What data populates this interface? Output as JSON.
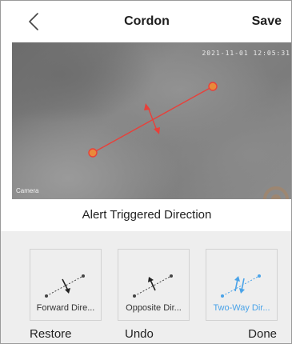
{
  "header": {
    "title": "Cordon",
    "save_label": "Save",
    "back_icon": "chevron-left-icon"
  },
  "camera": {
    "timestamp": "2021-11-01 12:05:31",
    "label": "Camera",
    "line_color": "#e8403a",
    "handle_color": "#e8403a"
  },
  "alert": {
    "heading": "Alert Triggered Direction"
  },
  "options": [
    {
      "label": "Forward Dire...",
      "icon": "forward-direction-icon",
      "selected": false
    },
    {
      "label": "Opposite Dir...",
      "icon": "opposite-direction-icon",
      "selected": false
    },
    {
      "label": "Two-Way Dir...",
      "icon": "two-way-direction-icon",
      "selected": true
    }
  ],
  "actions": {
    "restore": "Restore",
    "undo": "Undo",
    "done": "Done"
  },
  "colors": {
    "selected": "#4aa3e8",
    "normal": "#333333",
    "options_bg": "#eeeeee"
  }
}
